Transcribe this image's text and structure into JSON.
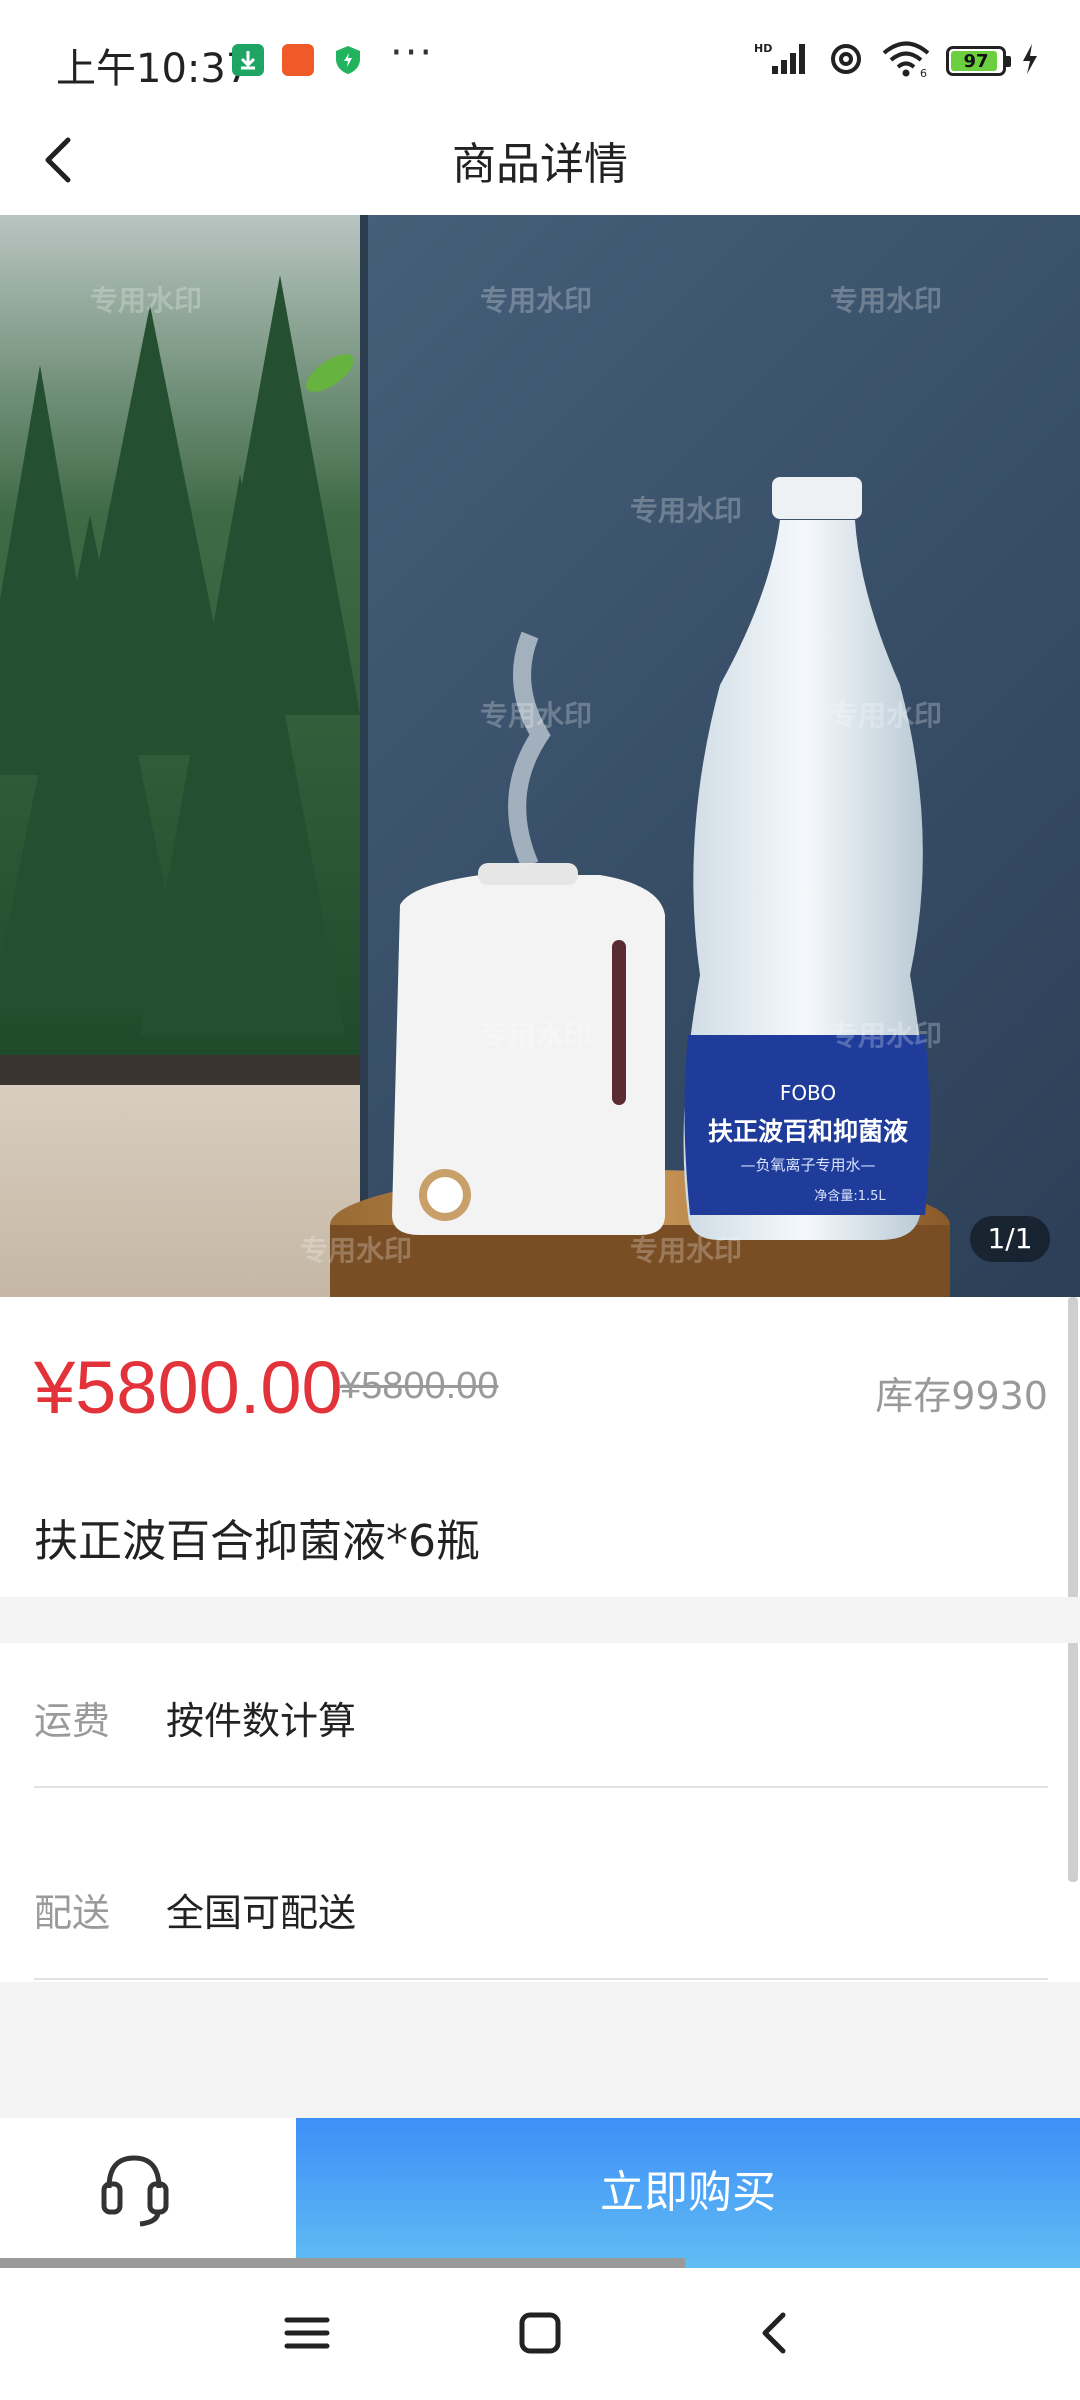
{
  "status_bar": {
    "time": "上午10:37",
    "battery_level": "97",
    "signal_label": "HD",
    "icons": [
      "download-notification-icon",
      "app-notification-icon",
      "shield-icon",
      "more-dots-icon",
      "signal-icon",
      "hotspot-icon",
      "wifi-icon",
      "battery-icon",
      "charging-icon"
    ]
  },
  "header": {
    "title": "商品详情"
  },
  "gallery": {
    "counter": "1/1",
    "product_label_brand": "FOBO",
    "product_label_name": "扶正波百和抑菌液",
    "product_label_sub": "—负氧离子专用水—",
    "product_label_volume": "净含量:1.5L",
    "watermark": "专用水印"
  },
  "product": {
    "price": "¥5800.00",
    "original_price": "¥5800.00",
    "stock": "库存9930",
    "name": "扶正波百合抑菌液*6瓶"
  },
  "info_rows": [
    {
      "key": "运费",
      "value": "按件数计算"
    },
    {
      "key": "配送",
      "value": "全国可配送"
    }
  ],
  "actions": {
    "buy_label": "立即购买"
  },
  "colors": {
    "price_red": "#e2333a",
    "buy_gradient_top": "#3e8ef7",
    "buy_gradient_bottom": "#60bdf4"
  }
}
